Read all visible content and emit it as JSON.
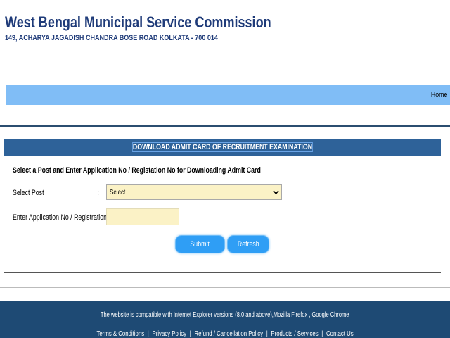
{
  "header": {
    "title": "West Bengal Municipal Service Commission",
    "address": "149, ACHARYA JAGADISH CHANDRA BOSE ROAD KOLKATA - 700 014"
  },
  "nav": {
    "home": "Home"
  },
  "panel": {
    "heading": "DOWNLOAD ADMIT CARD OF RECRUITMENT EXAMINATION",
    "instruction": "Select a Post and Enter Application No / Registation No for Downloading Admit Card"
  },
  "form": {
    "post_label": "Select Post",
    "colon": ":",
    "post_selected": "Select",
    "appno_label": "Enter Application No / Registration No",
    "appno_value": "",
    "submit_label": "Submit",
    "refresh_label": "Refresh"
  },
  "footer": {
    "compat": "The website is compatible with Internet Explorer versions (8.0 and above),Mozilla Firefox , Google Chrome",
    "links": [
      "Terms & Conditions",
      "Privacy Policy",
      "Refund / Cancellation Policy",
      "Products / Services",
      "Contact Us"
    ],
    "separator": "|"
  },
  "colors": {
    "title": "#1f3b79",
    "navbar": "#80bdf6",
    "panel_header": "#2e6299",
    "input_bg": "#fbf2c6",
    "button": "#2f9ef5",
    "footer": "#1e4a74"
  },
  "icons": {
    "select_arrow": "chevron-down-icon"
  }
}
